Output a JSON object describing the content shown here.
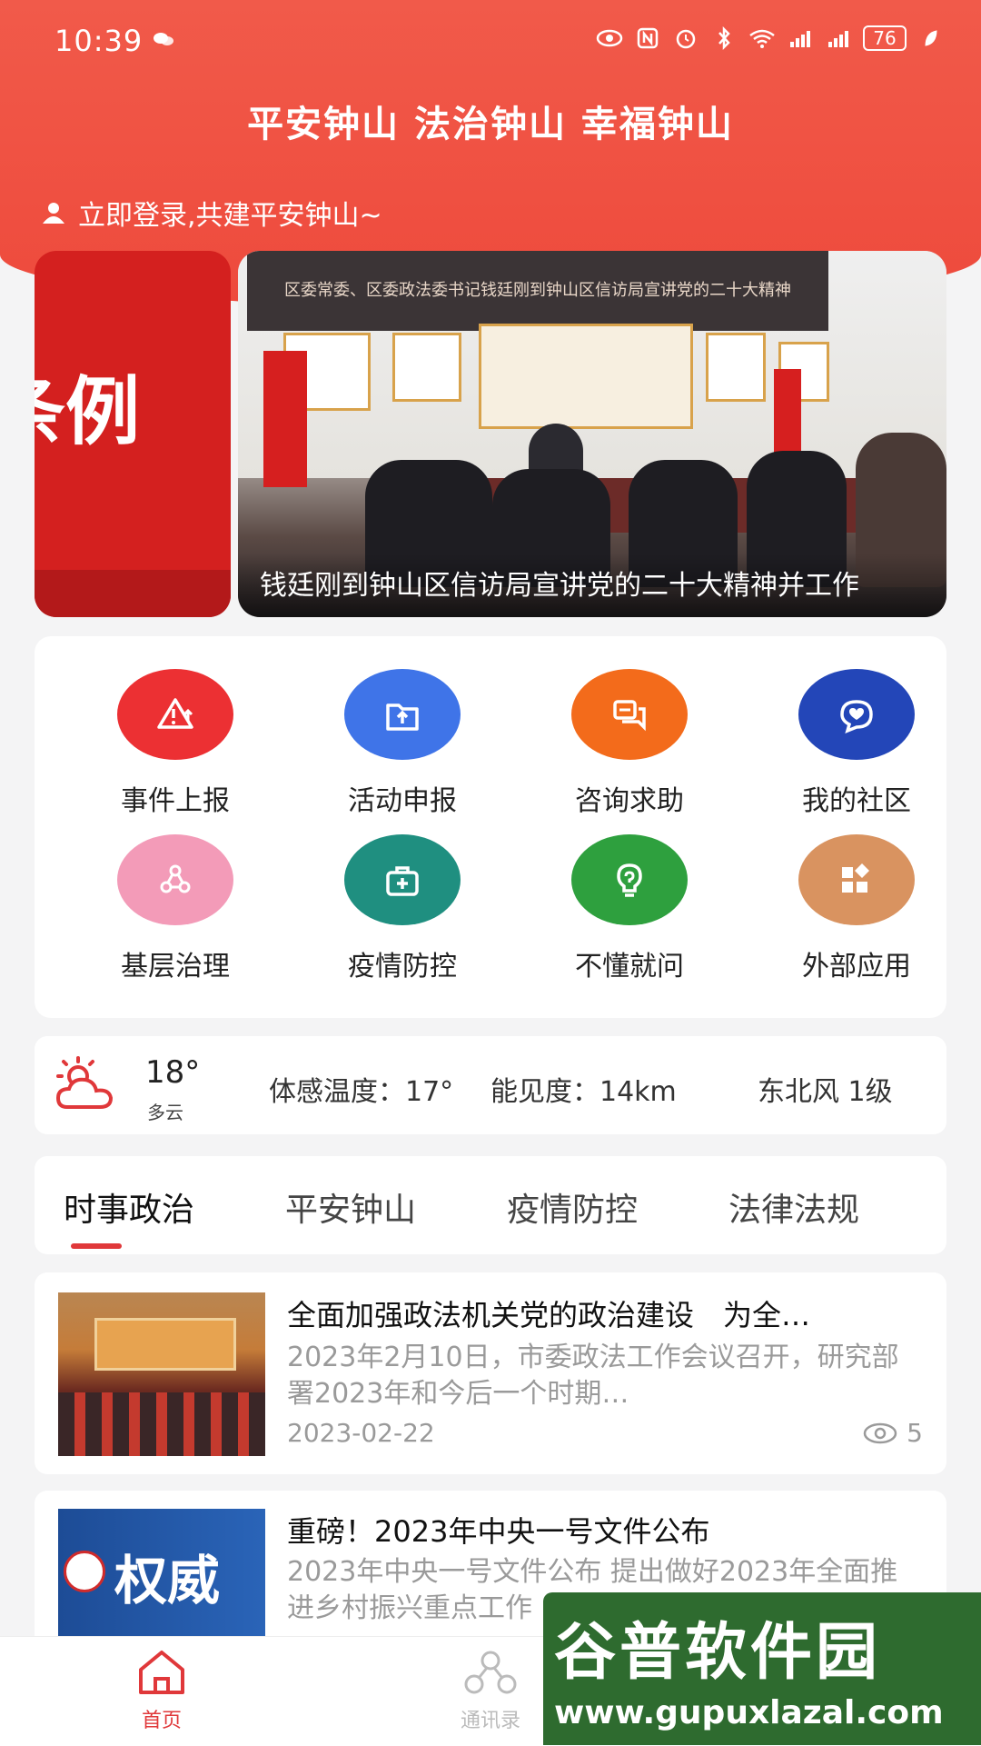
{
  "status_bar": {
    "time": "10:39",
    "battery": "76"
  },
  "header": {
    "slogan": "平安钟山 法治钟山 幸福钟山",
    "login_text": "立即登录,共建平安钟山~"
  },
  "banner": {
    "left_text": "条例",
    "sign_text": "区委常委、区委政法委书记钱廷刚到钟山区信访局宣讲党的二十大精神",
    "caption": "钱廷刚到钟山区信访局宣讲党的二十大精神并工作"
  },
  "services": [
    {
      "label": "事件上报",
      "color": "#ec3033",
      "icon": "warning-upload-icon"
    },
    {
      "label": "活动申报",
      "color": "#3f74e8",
      "icon": "folder-upload-icon"
    },
    {
      "label": "咨询求助",
      "color": "#f36b1b",
      "icon": "chat-bubbles-icon"
    },
    {
      "label": "我的社区",
      "color": "#2346b8",
      "icon": "heart-chat-icon"
    },
    {
      "label": "基层治理",
      "color": "#f39bb8",
      "icon": "hierarchy-icon"
    },
    {
      "label": "疫情防控",
      "color": "#1f8f80",
      "icon": "medical-kit-icon"
    },
    {
      "label": "不懂就问",
      "color": "#2ea03e",
      "icon": "question-bulb-icon"
    },
    {
      "label": "外部应用",
      "color": "#d99360",
      "icon": "apps-grid-icon"
    }
  ],
  "weather": {
    "temperature": "18°",
    "condition": "多云",
    "feels_like": "体感温度：17°",
    "visibility": "能见度：14km",
    "wind": "东北风  1级"
  },
  "tabs": [
    "时事政治",
    "平安钟山",
    "疫情防控",
    "法律法规"
  ],
  "active_tab": "时事政治",
  "news": [
    {
      "title": "全面加强政法机关党的政治建设　为全…",
      "summary": "2023年2月10日，市委政法工作会议召开，研究部署2023年和今后一个时期…",
      "date": "2023-02-22",
      "views": "5"
    },
    {
      "title": "重磅！2023年中央一号文件公布",
      "summary": "2023年中央一号文件公布 提出做好2023年全面推进乡村振兴重点工作",
      "thumb_text": "权威"
    }
  ],
  "bottom_nav": [
    {
      "label": "首页",
      "icon": "home-icon",
      "active": true
    },
    {
      "label": "通讯录",
      "icon": "contacts-icon",
      "active": false
    }
  ],
  "watermark": {
    "name": "谷普软件园",
    "url": "www.gupuxlazal.com"
  },
  "colors": {
    "brand_red": "#ee4a3c",
    "accent_red": "#e0383a"
  }
}
